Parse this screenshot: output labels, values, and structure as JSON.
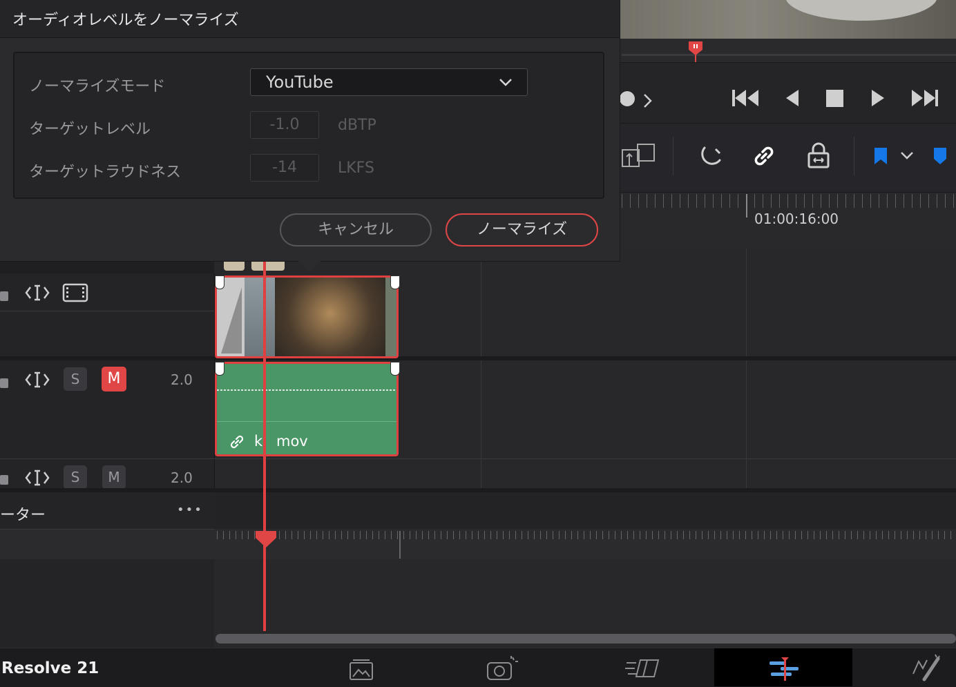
{
  "dialog": {
    "title": "オーディオレベルをノーマライズ",
    "mode_label": "ノーマライズモード",
    "mode_value": "YouTube",
    "target_level_label": "ターゲットレベル",
    "target_level_value": "-1.0",
    "target_level_unit": "dBTP",
    "target_loudness_label": "ターゲットラウドネス",
    "target_loudness_value": "-14",
    "target_loudness_unit": "LKFS",
    "cancel_label": "キャンセル",
    "normalize_label": "ノーマライズ"
  },
  "timeline": {
    "timecode": "01:00:16:00",
    "audio_track_1": {
      "solo": "S",
      "mute": "M",
      "channels": "2.0",
      "mute_active": true
    },
    "audio_track_2": {
      "solo": "S",
      "mute": "M",
      "channels": "2.0",
      "mute_active": false
    },
    "audio_clip_name": "k",
    "audio_clip_ext": "mov",
    "mixer_label": "ーター",
    "mixer_menu": "•••"
  },
  "app": {
    "name": "Resolve 21"
  },
  "icons": {
    "transport": [
      "skip-start-icon",
      "play-reverse-icon",
      "stop-icon",
      "play-icon",
      "skip-end-icon"
    ],
    "pages": [
      "media-page-icon",
      "cut-page-icon",
      "edit-page-icon",
      "fairlight-page-icon",
      "fusion-page-icon"
    ]
  },
  "colors": {
    "accent_red": "#e04646",
    "audio_clip": "#4a9667",
    "marker_blue": "#1478e8"
  }
}
